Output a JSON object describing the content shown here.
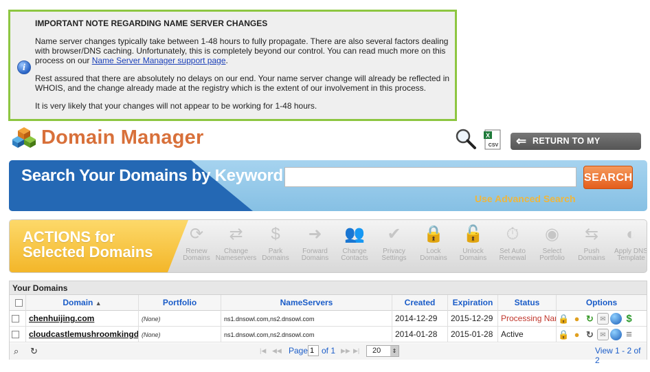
{
  "notice": {
    "heading": "IMPORTANT NOTE REGARDING NAME SERVER CHANGES",
    "p1_text": "Name server changes typically take between 1-48 hours to fully propagate. There are also several factors dealing with browser/DNS caching. Unfortunately, this is completely beyond our control. You can read much more on this process on our ",
    "p1_link": "Name Server Manager support page",
    "p1_end": ".",
    "p2": "Rest assured that there are absolutely no delays on our end. Your name server change will already be reflected in WHOIS, and the change already made at the registry which is the extent of our involvement in this process.",
    "p3": "It is very likely that your changes will not appear to be working for 1-48 hours.",
    "icon": "info-icon"
  },
  "header": {
    "title": "Domain Manager",
    "return_label": "RETURN TO MY ACCOUNT",
    "csv_label": "CSV"
  },
  "search": {
    "heading": "Search Your Domains by Keyword",
    "value": "",
    "placeholder": "",
    "button_label": "SEARCH",
    "advanced_link": "Use Advanced Search"
  },
  "actions": {
    "title_line1": "ACTIONS for",
    "title_line2": "Selected Domains",
    "items": [
      {
        "line1": "Renew",
        "line2": "Domains",
        "icon": "renew-icon",
        "glyph": "⟳"
      },
      {
        "line1": "Change",
        "line2": "Nameservers",
        "icon": "change-nameservers-icon",
        "glyph": "⇄"
      },
      {
        "line1": "Park",
        "line2": "Domains",
        "icon": "park-icon",
        "glyph": "$"
      },
      {
        "line1": "Forward",
        "line2": "Domains",
        "icon": "forward-icon",
        "glyph": "➜"
      },
      {
        "line1": "Change",
        "line2": "Contacts",
        "icon": "contacts-icon",
        "glyph": "👥"
      },
      {
        "line1": "Privacy",
        "line2": "Settings",
        "icon": "privacy-icon",
        "glyph": "✔"
      },
      {
        "line1": "Lock",
        "line2": "Domains",
        "icon": "lock-icon",
        "glyph": "🔒"
      },
      {
        "line1": "Unlock",
        "line2": "Domains",
        "icon": "unlock-icon",
        "glyph": "🔓"
      },
      {
        "line1": "Set Auto",
        "line2": "Renewal",
        "icon": "auto-renewal-icon",
        "glyph": "⏱"
      },
      {
        "line1": "Select",
        "line2": "Portfolio",
        "icon": "portfolio-icon",
        "glyph": "◉"
      },
      {
        "line1": "Push",
        "line2": "Domains",
        "icon": "push-icon",
        "glyph": "⇆"
      },
      {
        "line1": "Apply DNS",
        "line2": "Template",
        "icon": "dns-template-icon",
        "glyph": "◐"
      }
    ]
  },
  "table": {
    "caption": "Your Domains",
    "columns": [
      "Domain",
      "Portfolio",
      "NameServers",
      "Created",
      "Expiration",
      "Status",
      "Options"
    ],
    "sort_indicator": "▲",
    "rows": [
      {
        "domain": "chenhuijing.com",
        "portfolio": "(None)",
        "nameservers": "ns1.dnsowl.com,ns2.dnsowl.com",
        "created": "2014-12-29",
        "expiration": "2015-12-29",
        "status": "Processing Nam"
      },
      {
        "domain": "cloudcastlemushroomkingdom",
        "portfolio": "(None)",
        "nameservers": "ns1.dnsowl.com,ns2.dnsowl.com",
        "created": "2014-01-28",
        "expiration": "2015-01-28",
        "status": "Active"
      }
    ],
    "pager": {
      "page_label": "Page",
      "page_value": "1",
      "of_label": "of 1",
      "per_page": "20",
      "summary": "View 1 - 2 of 2"
    }
  },
  "colors": {
    "accent_orange": "#d8703a",
    "notice_border": "#8dc641",
    "search_blue": "#2468b4",
    "actions_yellow": "#f3b629",
    "link_blue": "#1a5cc8",
    "status_red": "#c0352a"
  }
}
